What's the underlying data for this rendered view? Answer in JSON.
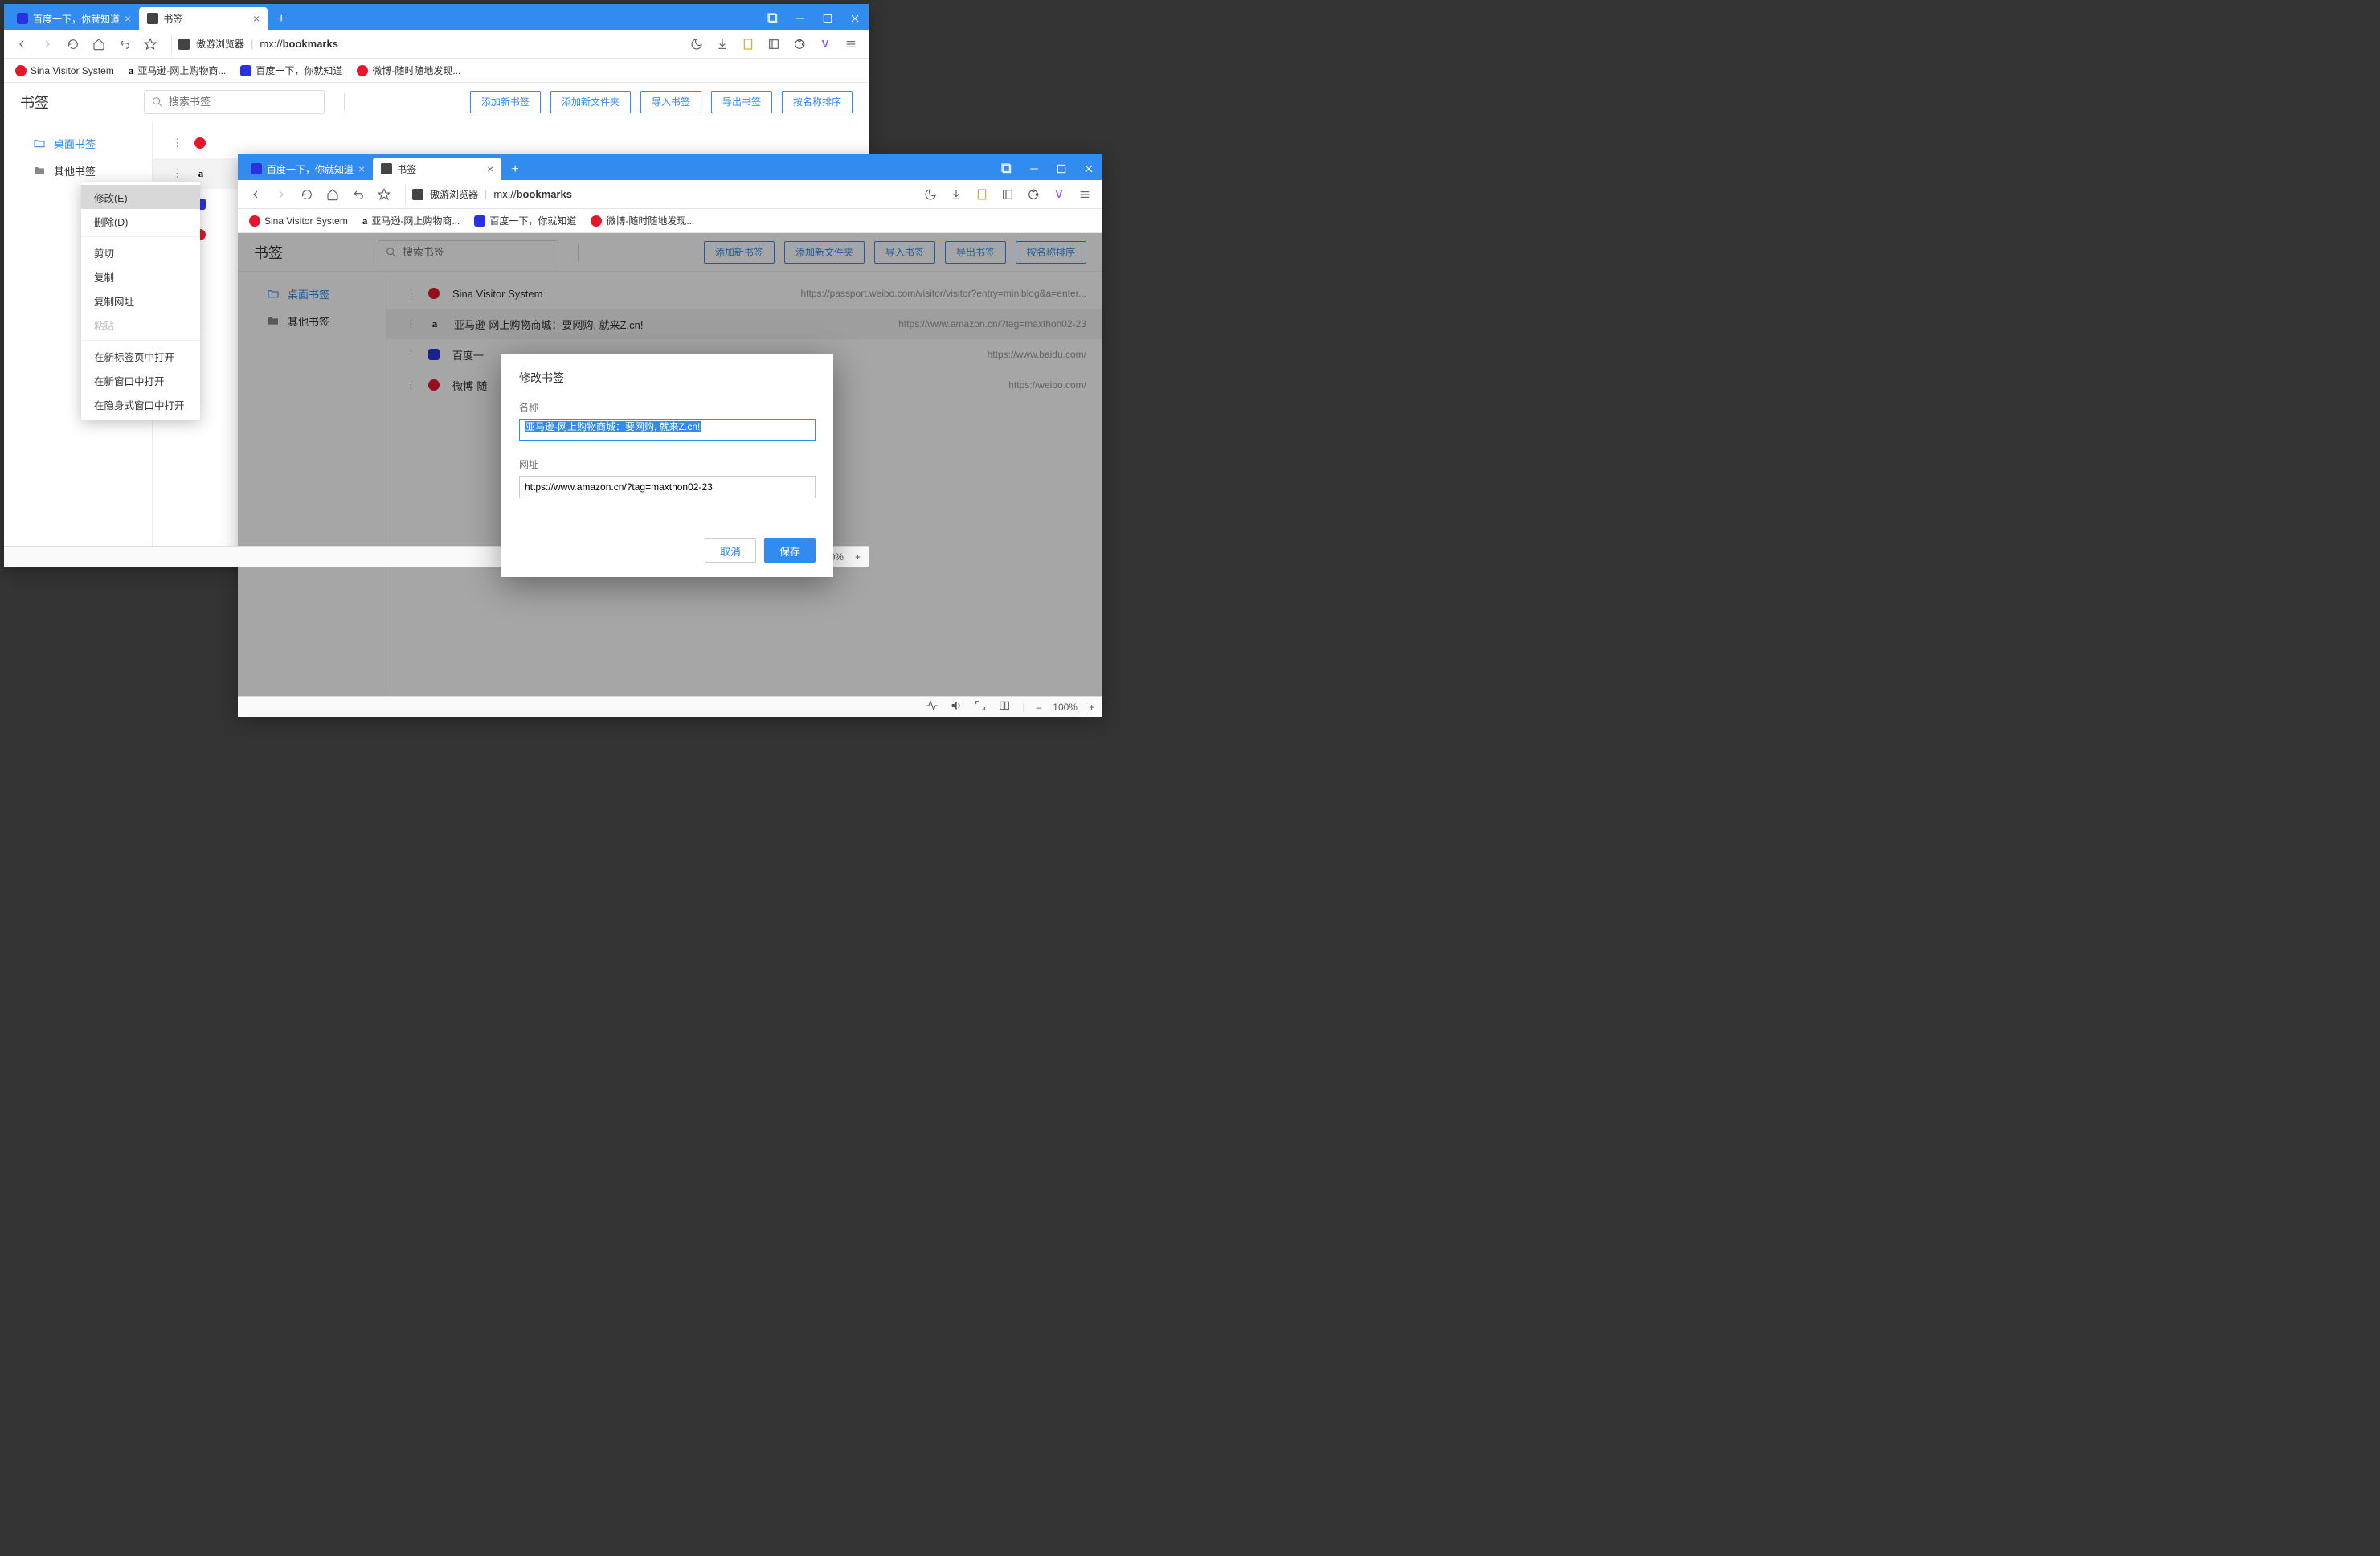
{
  "tabbar": {
    "tab1": "百度一下，你就知道",
    "tab2": "书签",
    "add": "+"
  },
  "toolbar": {
    "browser_name": "傲游浏览器",
    "url_prefix": "mx://",
    "url_path": "bookmarks"
  },
  "bookmarks_bar": {
    "i0": "Sina Visitor System",
    "i1": "亚马逊-网上购物商...",
    "i2": "百度一下，你就知道",
    "i3": "微博-随时随地发现..."
  },
  "page": {
    "title": "书签",
    "search_placeholder": "搜索书签",
    "actions": {
      "add_bookmark": "添加新书签",
      "add_folder": "添加新文件夹",
      "import": "导入书签",
      "export": "导出书签",
      "sort": "按名称排序"
    }
  },
  "sidebar": {
    "desktop": "桌面书签",
    "other": "其他书签"
  },
  "list": {
    "r0": {
      "title": "Sina Visitor System",
      "url": "https://passport.weibo.com/visitor/visitor?entry=miniblog&a=enter..."
    },
    "r1": {
      "title": "亚马逊-网上购物商城：要网购, 就来Z.cn!",
      "url": "https://www.amazon.cn/?tag=maxthon02-23"
    },
    "r2": {
      "title": "百度一下，你就知道",
      "url": "https://www.baidu.com/"
    },
    "r3": {
      "title": "微博-随时随地发现新鲜事",
      "url": "https://weibo.com/"
    },
    "r2_short": "百度一",
    "r3_short": "微博-随"
  },
  "context_menu": {
    "edit": "修改(E)",
    "delete": "删除(D)",
    "cut": "剪切",
    "copy": "复制",
    "copy_url": "复制网址",
    "paste": "粘贴",
    "open_tab": "在新标签页中打开",
    "open_window": "在新窗口中打开",
    "open_incognito": "在隐身式窗口中打开"
  },
  "dialog": {
    "title": "修改书签",
    "name_label": "名称",
    "name_value": "亚马逊-网上购物商城：要网购, 就来Z.cn!",
    "url_label": "网址",
    "url_value": "https://www.amazon.cn/?tag=maxthon02-23",
    "cancel": "取消",
    "save": "保存"
  },
  "status": {
    "zoom": "100%",
    "minus": "–",
    "plus": "+"
  }
}
